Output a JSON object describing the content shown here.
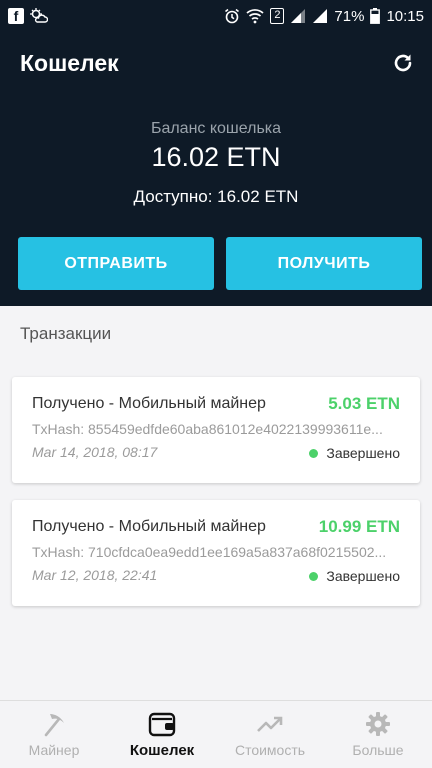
{
  "status_bar": {
    "battery": "71%",
    "time": "10:15",
    "sim": "2"
  },
  "header": {
    "title": "Кошелек",
    "balance_label": "Баланс кошелька",
    "balance_value": "16.02 ETN",
    "available": "Доступно: 16.02 ETN",
    "send_label": "ОТПРАВИТЬ",
    "receive_label": "ПОЛУЧИТЬ"
  },
  "transactions": {
    "title": "Транзакции",
    "items": [
      {
        "description": "Получено - Мобильный майнер",
        "amount": "5.03 ETN",
        "hash": "TxHash: 855459edfde60aba861012e4022139993611e...",
        "date": "Mar 14, 2018, 08:17",
        "status": "Завершено"
      },
      {
        "description": "Получено - Мобильный майнер",
        "amount": "10.99 ETN",
        "hash": "TxHash: 710cfdca0ea9edd1ee169a5a837a68f0215502...",
        "date": "Mar 12, 2018, 22:41",
        "status": "Завершено"
      }
    ]
  },
  "nav": {
    "items": [
      {
        "label": "Майнер",
        "icon": "pickaxe-icon"
      },
      {
        "label": "Кошелек",
        "icon": "wallet-icon"
      },
      {
        "label": "Стоимость",
        "icon": "trending-up-icon"
      },
      {
        "label": "Больше",
        "icon": "gear-icon"
      }
    ],
    "active_index": 1
  },
  "colors": {
    "header_bg": "#0e1a27",
    "accent": "#26c1e3",
    "positive": "#4cd16a"
  }
}
